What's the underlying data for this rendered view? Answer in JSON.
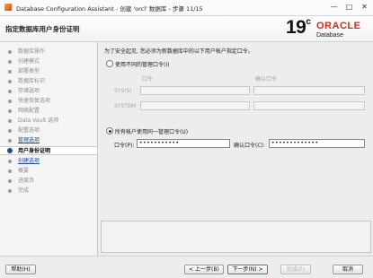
{
  "window": {
    "title": "Database Configuration Assistant - 创建 'orcl' 数据库 - 步骤 11/15",
    "minimize_glyph": "—",
    "maximize_glyph": "□",
    "close_glyph": "✕"
  },
  "header": {
    "page_title": "指定数据库用户身份证明",
    "logo_version": "19",
    "logo_version_suffix": "c",
    "logo_brand": "ORACLE",
    "logo_product": "Database"
  },
  "steps": [
    {
      "label": "数据库操作",
      "state": "done"
    },
    {
      "label": "创建模式",
      "state": "done"
    },
    {
      "label": "部署类型",
      "state": "done"
    },
    {
      "label": "数据库标识",
      "state": "done"
    },
    {
      "label": "存储选项",
      "state": "done"
    },
    {
      "label": "快速恢复选项",
      "state": "done"
    },
    {
      "label": "网络配置",
      "state": "done"
    },
    {
      "label": "Data Vault 选项",
      "state": "done"
    },
    {
      "label": "配置选项",
      "state": "done"
    },
    {
      "label": "管理选项",
      "state": "link"
    },
    {
      "label": "用户身份证明",
      "state": "current"
    },
    {
      "label": "创建选项",
      "state": "link"
    },
    {
      "label": "概要",
      "state": "pending"
    },
    {
      "label": "进度页",
      "state": "pending"
    },
    {
      "label": "完成",
      "state": "pending"
    }
  ],
  "content": {
    "intro": "为了安全起见, 您必须为新数据库中的以下用户帐户指定口令。",
    "option_different": "使用不同的管理口令(I)",
    "col_password": "口令",
    "col_confirm": "确认口令",
    "row_sys": "SYS(S)",
    "row_system": "SYSTEM",
    "option_same": "所有帐户使用同一管理口令(U)",
    "same_password_label": "口令(P):",
    "same_password_value": "•••••••••••",
    "same_confirm_label": "确认口令(C):",
    "same_confirm_value": "•••••••••••••"
  },
  "footer": {
    "help": "帮助(H)",
    "back": "< 上一步(B)",
    "next": "下一步(N) >",
    "finish": "完成(F)",
    "cancel": "取消"
  }
}
